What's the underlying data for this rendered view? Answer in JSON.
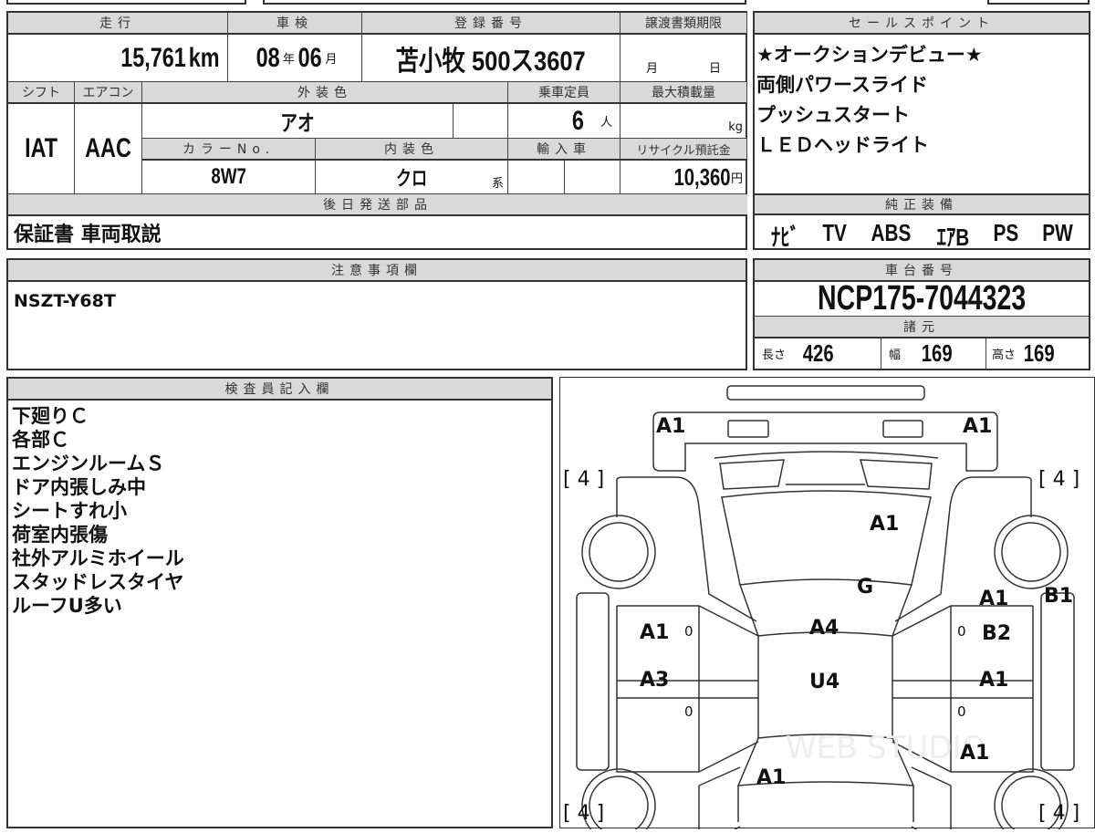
{
  "vehicle": {
    "headers": {
      "mileage": "走行",
      "inspection": "車検",
      "registration": "登録番号",
      "transfer_deadline": "譲渡書類期限",
      "shift": "シフト",
      "aircon": "エアコン",
      "exterior_color": "外装色",
      "capacity": "乗車定員",
      "max_load": "最大積載量",
      "color_no": "カラーNo.",
      "interior_color": "内装色",
      "import": "輸入車",
      "recycle": "リサイクル預託金",
      "later_parts": "後日発送部品"
    },
    "mileage": "15,761",
    "mileage_unit": "km",
    "inspection_year": "08",
    "year_unit": "年",
    "inspection_month": "06",
    "month_unit": "月",
    "registration": "苫小牧 500ス3607",
    "deadline_month": "月",
    "deadline_day": "日",
    "shift": "IAT",
    "aircon": "AAC",
    "exterior_color": "アオ",
    "capacity": "6",
    "capacity_unit": "人",
    "load_unit": "kg",
    "color_no": "8W7",
    "interior_color": "クロ",
    "interior_suffix": "系",
    "recycle": "10,360",
    "recycle_unit": "円",
    "later_parts": "保証書 車両取説"
  },
  "sales_points": {
    "header": "セールスポイント",
    "items": [
      "★オークションデビュー★",
      "両側パワースライド",
      "プッシュスタート",
      "ＬＥＤヘッドライト"
    ]
  },
  "equipment": {
    "header": "純正装備",
    "items": [
      "ﾅﾋﾞ",
      "TV",
      "ABS",
      "ｴｱB",
      "PS",
      "PW"
    ]
  },
  "notes": {
    "header": "注意事項欄",
    "text": "NSZT-Y68T"
  },
  "chassis": {
    "header": "車台番号",
    "number": "NCP175-7044323",
    "spec_header": "諸元",
    "length_label": "長さ",
    "length": "426",
    "width_label": "幅",
    "width": "169",
    "height_label": "高さ",
    "height": "169"
  },
  "inspector": {
    "header": "検査員記入欄",
    "lines": [
      "下廻りＣ",
      "各部Ｃ",
      "エンジンルームＳ",
      "ドア内張しみ中",
      "シートすれ小",
      "荷室内張傷",
      "社外アルミホイール",
      "スタッドレスタイヤ",
      "ルーフU多い"
    ]
  },
  "diagram": {
    "front_left": "A1",
    "front_right": "A1",
    "tire_fl": "[ 4 ]",
    "tire_fr": "[ 4 ]",
    "tire_rl": "[ 4 ]",
    "tire_rr": "[ 4 ]",
    "hood": "A1",
    "windshield": "G",
    "roof_front": "A4",
    "roof_rear": "U4",
    "left_front_door": "A1",
    "left_front_zero": "0",
    "left_rear_door": "A3",
    "left_rear_zero": "0",
    "right_front_door_a": "A1",
    "right_front_door_b": "B2",
    "right_front_zero": "0",
    "right_rear_door": "A1",
    "right_rear_zero": "0",
    "right_step": "B1",
    "rear_quarter_right": "A1",
    "back_door": "A1",
    "watermark": "WEB STUDIO"
  }
}
